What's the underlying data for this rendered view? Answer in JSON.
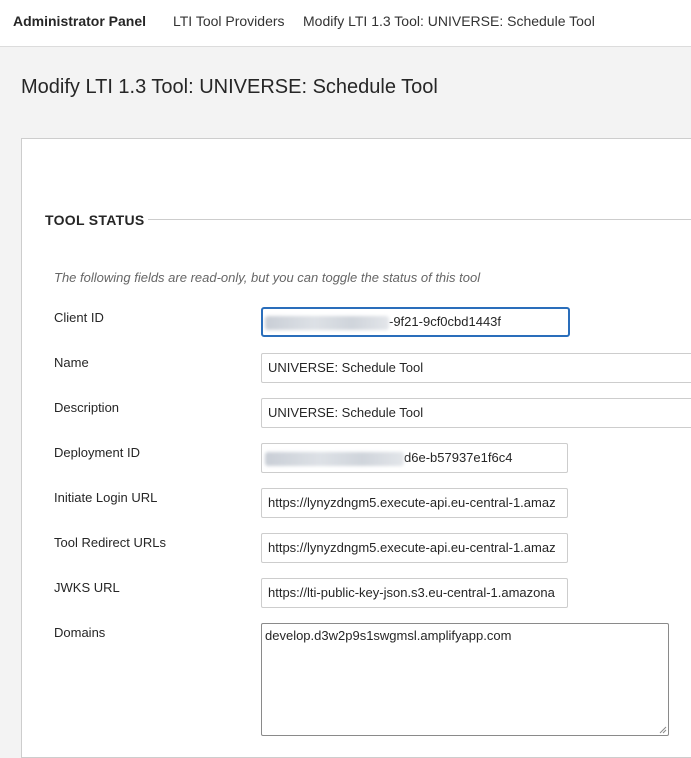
{
  "breadcrumb": {
    "items": [
      "Administrator Panel",
      "LTI Tool Providers",
      "Modify LTI 1.3 Tool: UNIVERSE: Schedule Tool"
    ]
  },
  "page": {
    "title": "Modify LTI 1.3 Tool: UNIVERSE: Schedule Tool"
  },
  "section": {
    "title": "TOOL STATUS",
    "note": "The following fields are read-only, but you can toggle the status of this tool"
  },
  "fields": {
    "client_id": {
      "label": "Client ID",
      "value_visible": "-9f21-9cf0cbd1443f"
    },
    "name": {
      "label": "Name",
      "value": "UNIVERSE: Schedule Tool"
    },
    "description": {
      "label": "Description",
      "value": "UNIVERSE: Schedule Tool"
    },
    "deployment_id": {
      "label": "Deployment ID",
      "value_visible": "d6e-b57937e1f6c4"
    },
    "initiate_login_url": {
      "label": "Initiate Login URL",
      "value": "https://lynyzdngm5.execute-api.eu-central-1.amaz"
    },
    "tool_redirect_urls": {
      "label": "Tool Redirect URLs",
      "value": "https://lynyzdngm5.execute-api.eu-central-1.amaz"
    },
    "jwks_url": {
      "label": "JWKS URL",
      "value": "https://lti-public-key-json.s3.eu-central-1.amazona"
    },
    "domains": {
      "label": "Domains",
      "value": "develop.d3w2p9s1swgmsl.amplifyapp.com"
    }
  },
  "colors": {
    "focus": "#2a6ebb",
    "background": "#f3f3f3",
    "card": "#ffffff"
  }
}
